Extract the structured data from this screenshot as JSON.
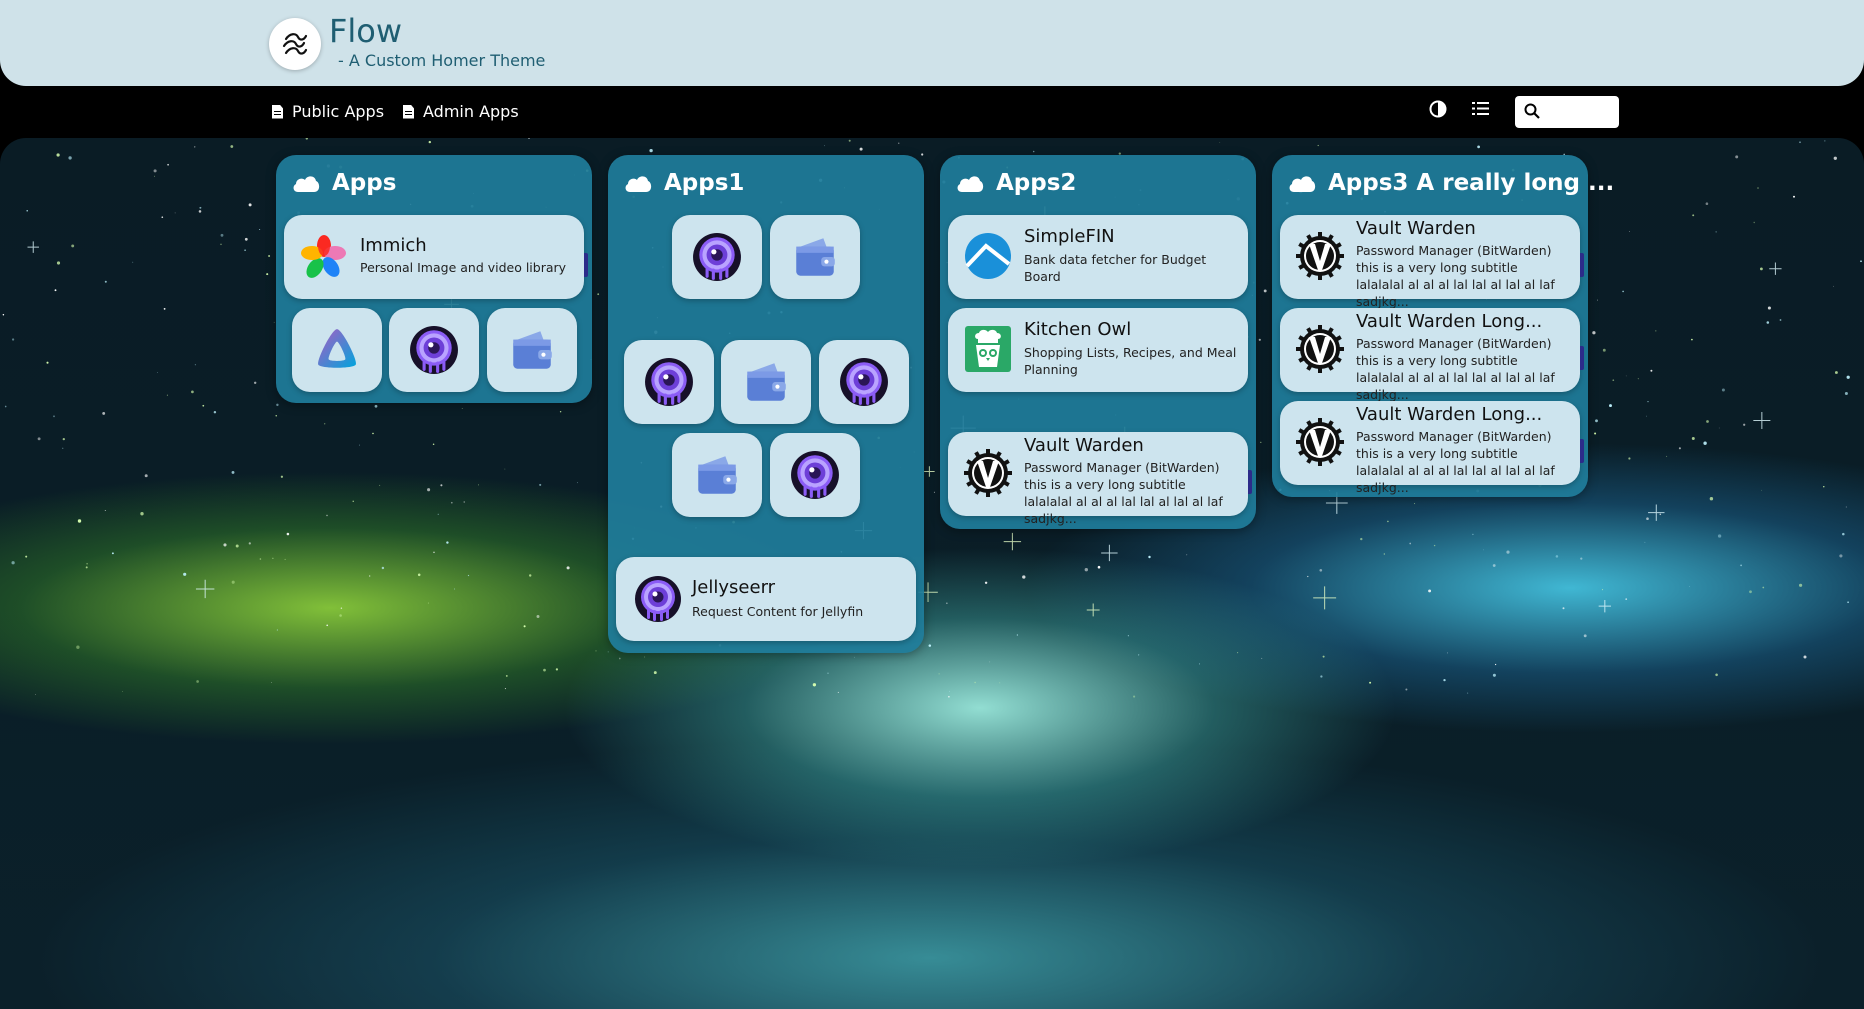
{
  "header": {
    "title": "Flow",
    "subtitle": "- A Custom Homer Theme",
    "logo_icon": "flow-logo"
  },
  "nav": {
    "links": [
      {
        "label": "Public Apps",
        "icon": "file-icon"
      },
      {
        "label": "Admin Apps",
        "icon": "file-icon"
      }
    ],
    "tools": [
      {
        "icon": "contrast-icon"
      },
      {
        "icon": "list-view-icon"
      }
    ],
    "search": {
      "value": "",
      "placeholder": ""
    }
  },
  "groups": [
    {
      "title": "Apps",
      "icon": "cloud-icon",
      "cards": [
        {
          "title": "Immich",
          "subtitle": "Personal Image and video library",
          "icon": "immich-icon"
        }
      ],
      "tiles": [
        {
          "icon": "jellyfin-icon"
        },
        {
          "icon": "jellyseerr-icon"
        },
        {
          "icon": "wallet-icon"
        }
      ]
    },
    {
      "title": "Apps1",
      "icon": "cloud-icon",
      "tiles": [
        {
          "icon": "jellyseerr-icon"
        },
        {
          "icon": "wallet-icon"
        },
        {
          "icon": "jellyseerr-icon"
        },
        {
          "icon": "wallet-icon"
        },
        {
          "icon": "jellyseerr-icon"
        },
        {
          "icon": "wallet-icon"
        },
        {
          "icon": "jellyseerr-icon"
        }
      ],
      "cards": [
        {
          "title": "Jellyseerr",
          "subtitle": "Request Content for Jellyfin",
          "icon": "jellyseerr-icon"
        }
      ]
    },
    {
      "title": "Apps2",
      "icon": "cloud-icon",
      "cards": [
        {
          "title": "SimpleFIN",
          "subtitle": "Bank data fetcher for Budget Board",
          "icon": "simplefin-icon"
        },
        {
          "title": "Kitchen Owl",
          "subtitle": "Shopping Lists, Recipes, and Meal Planning",
          "icon": "kitchenowl-icon"
        },
        {
          "title": "Vault Warden",
          "subtitle": "Password Manager (BitWarden)",
          "subtitle2": "this is a very long subtitle lalalalal al al al lal lal al lal al laf sadjkg...",
          "icon": "vaultwarden-icon"
        }
      ]
    },
    {
      "title": "Apps3 A really long ...",
      "icon": "cloud-icon",
      "cards": [
        {
          "title": "Vault Warden",
          "subtitle": "Password Manager (BitWarden)",
          "subtitle2": "this is a very long subtitle lalalalal al al al lal lal al lal al laf sadjkg...",
          "icon": "vaultwarden-icon"
        },
        {
          "title": "Vault Warden Long...",
          "subtitle": "Password Manager (BitWarden)",
          "subtitle2": "this is a very long subtitle lalalalal al al al lal lal al lal al laf sadjkg...",
          "icon": "vaultwarden-icon"
        },
        {
          "title": "Vault Warden Long...",
          "subtitle": "Password Manager (BitWarden)",
          "subtitle2": "this is a very long subtitle lalalalal al al al lal lal al lal al laf sadjkg...",
          "icon": "vaultwarden-icon"
        }
      ]
    }
  ]
}
